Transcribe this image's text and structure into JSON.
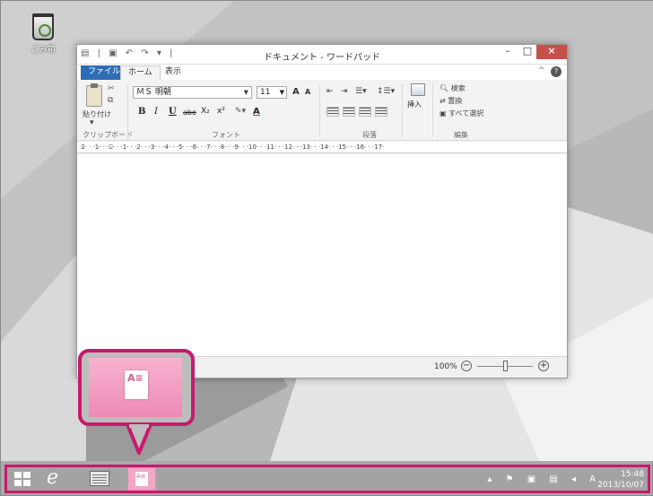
{
  "desktop": {
    "recycle_bin_label": "ごみ箱"
  },
  "window": {
    "title": "ドキュメント - ワードパッド",
    "qat": "▤ | ▣ ↶ ↷ ▾ |",
    "min": "–",
    "max": "□",
    "close": "×",
    "tabs": {
      "file": "ファイル",
      "home": "ホーム",
      "view": "表示"
    },
    "collapse": "^",
    "help": "?"
  },
  "ribbon": {
    "clipboard": {
      "paste": "貼り付け",
      "paste_arrow": "▾",
      "cut": "✂",
      "copy": "⧉",
      "label": "クリップボード"
    },
    "font": {
      "name": "ＭＳ 明朝",
      "size": "11",
      "grow": "A",
      "shrink": "A",
      "bold": "B",
      "italic": "I",
      "underline": "U",
      "strike": "abe",
      "subscript": "X₂",
      "superscript": "x²",
      "highlight": "✎▾",
      "color": "A",
      "label": "フォント"
    },
    "paragraph": {
      "decrease": "⇤",
      "increase": "⇥",
      "bullets": "☰▾",
      "spacing": "↕☰▾",
      "label": "段落"
    },
    "insert": {
      "label": "挿入"
    },
    "editing": {
      "find": "検索",
      "replace": "置換",
      "select_all": "すべて選択",
      "label": "編集"
    }
  },
  "ruler": {
    "text": "·2· · ·1· · ·⍓· · ·1· · ·2· · ·3· · ·4· · ·5· · ·6· · ·7· · ·8· · ·9· · ·10· · ·11· · ·12· · ·13· · ·14· · ·15· · ·16· · ·17·"
  },
  "status": {
    "zoom": "100%",
    "zoom_level_percent": 100,
    "minus": "−",
    "plus": "+"
  },
  "taskbar": {
    "ie_glyph": "e",
    "tray": "▴ ⚑ ▣ ▤ ◂ A",
    "time": "15:48",
    "date": "2013/10/07"
  },
  "colors": {
    "highlight": "#c8196d",
    "tile": "#ec8ab4",
    "file_tab": "#2d6db6",
    "close": "#c7504a"
  }
}
